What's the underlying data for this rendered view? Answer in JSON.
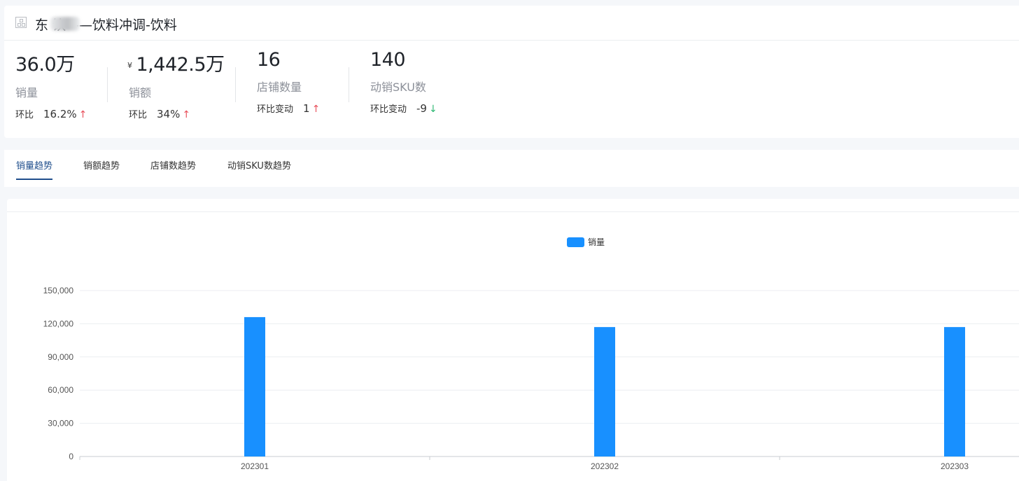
{
  "header": {
    "title": "东 饮——饮料冲调-饮料"
  },
  "metrics": [
    {
      "value": "36.0万",
      "currency": "",
      "label": "销量",
      "change_label": "环比",
      "change_value": "16.2%",
      "direction": "up"
    },
    {
      "value": "1,442.5万",
      "currency": "¥",
      "label": "销额",
      "change_label": "环比",
      "change_value": "34%",
      "direction": "up"
    },
    {
      "value": "16",
      "currency": "",
      "label": "店铺数量",
      "change_label": "环比变动",
      "change_value": "1",
      "direction": "up"
    },
    {
      "value": "140",
      "currency": "",
      "label": "动销SKU数",
      "change_label": "环比变动",
      "change_value": "-9",
      "direction": "down"
    }
  ],
  "tabs": [
    {
      "label": "销量趋势",
      "active": true
    },
    {
      "label": "销额趋势",
      "active": false
    },
    {
      "label": "店铺数趋势",
      "active": false
    },
    {
      "label": "动销SKU数趋势",
      "active": false
    }
  ],
  "colors": {
    "bar": "#1890ff",
    "up": "#e8505b",
    "down": "#2fb873",
    "accent": "#1f4e8c"
  },
  "chart_data": {
    "type": "bar",
    "categories": [
      "202301",
      "202302",
      "202303"
    ],
    "series": [
      {
        "name": "销量",
        "values": [
          126000,
          117000,
          117000
        ]
      }
    ],
    "yticks": [
      "150,000",
      "120,000",
      "90,000",
      "60,000",
      "30,000",
      "0"
    ],
    "ylim": [
      0,
      150000
    ],
    "grid": true,
    "legend": "top-center"
  }
}
